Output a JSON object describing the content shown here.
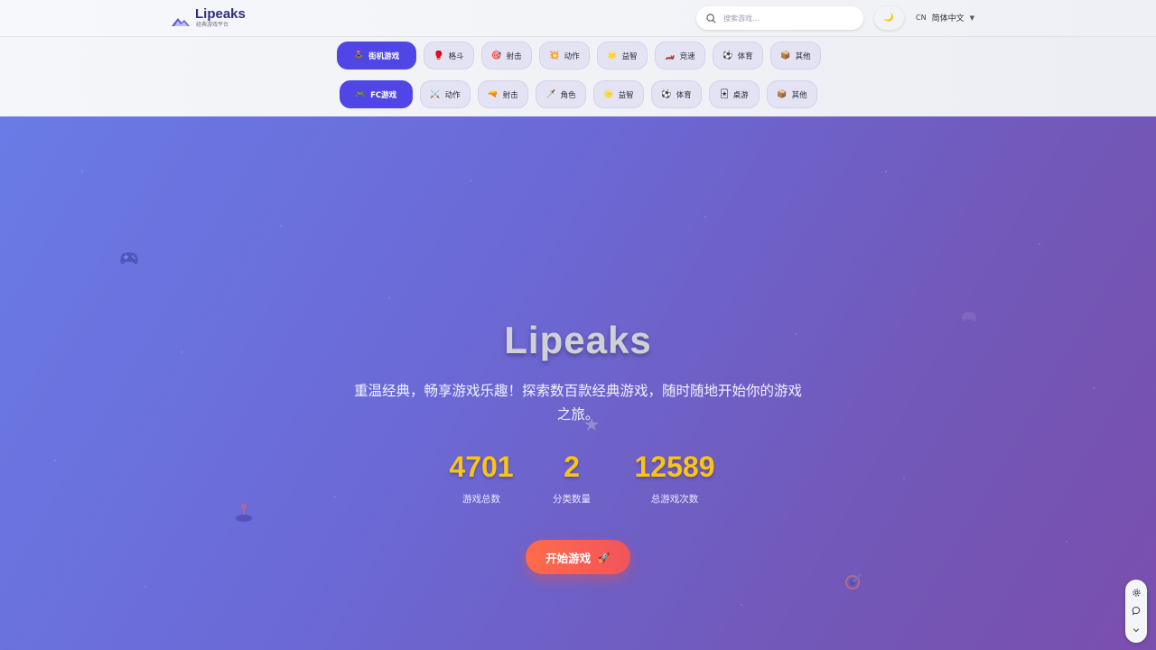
{
  "header": {
    "logo_title": "Lipeaks",
    "logo_subtitle": "经典游戏平台",
    "search_placeholder": "搜索游戏...",
    "theme_icon": "moon-icon",
    "lang_code": "CN",
    "lang_label": "简体中文"
  },
  "categories": {
    "row1": [
      {
        "label": "街机游戏",
        "icon": "🕹️",
        "active": true
      },
      {
        "label": "格斗",
        "icon": "🥊"
      },
      {
        "label": "射击",
        "icon": "🎯"
      },
      {
        "label": "动作",
        "icon": "💥"
      },
      {
        "label": "益智",
        "icon": "🌟"
      },
      {
        "label": "竞速",
        "icon": "🏎️"
      },
      {
        "label": "体育",
        "icon": "⚽"
      },
      {
        "label": "其他",
        "icon": "📦"
      }
    ],
    "row2": [
      {
        "label": "FC游戏",
        "icon": "🎮",
        "active": true
      },
      {
        "label": "动作",
        "icon": "⚔️"
      },
      {
        "label": "射击",
        "icon": "🔫"
      },
      {
        "label": "角色",
        "icon": "🗡️"
      },
      {
        "label": "益智",
        "icon": "🌟"
      },
      {
        "label": "体育",
        "icon": "⚽"
      },
      {
        "label": "桌游",
        "icon": "🃏"
      },
      {
        "label": "其他",
        "icon": "📦"
      }
    ]
  },
  "hero": {
    "title": "Lipeaks",
    "subtitle": "重温经典，畅享游戏乐趣！探索数百款经典游戏，随时随地开始你的游戏之旅。",
    "stats": [
      {
        "value": "4701",
        "label": "游戏总数"
      },
      {
        "value": "2",
        "label": "分类数量"
      },
      {
        "value": "12589",
        "label": "总游戏次数"
      }
    ],
    "start_label": "开始游戏",
    "start_icon": "🚀"
  },
  "colors": {
    "accent": "#4f46e5",
    "stat": "#f8c415",
    "cta": "#ff6b4a"
  }
}
